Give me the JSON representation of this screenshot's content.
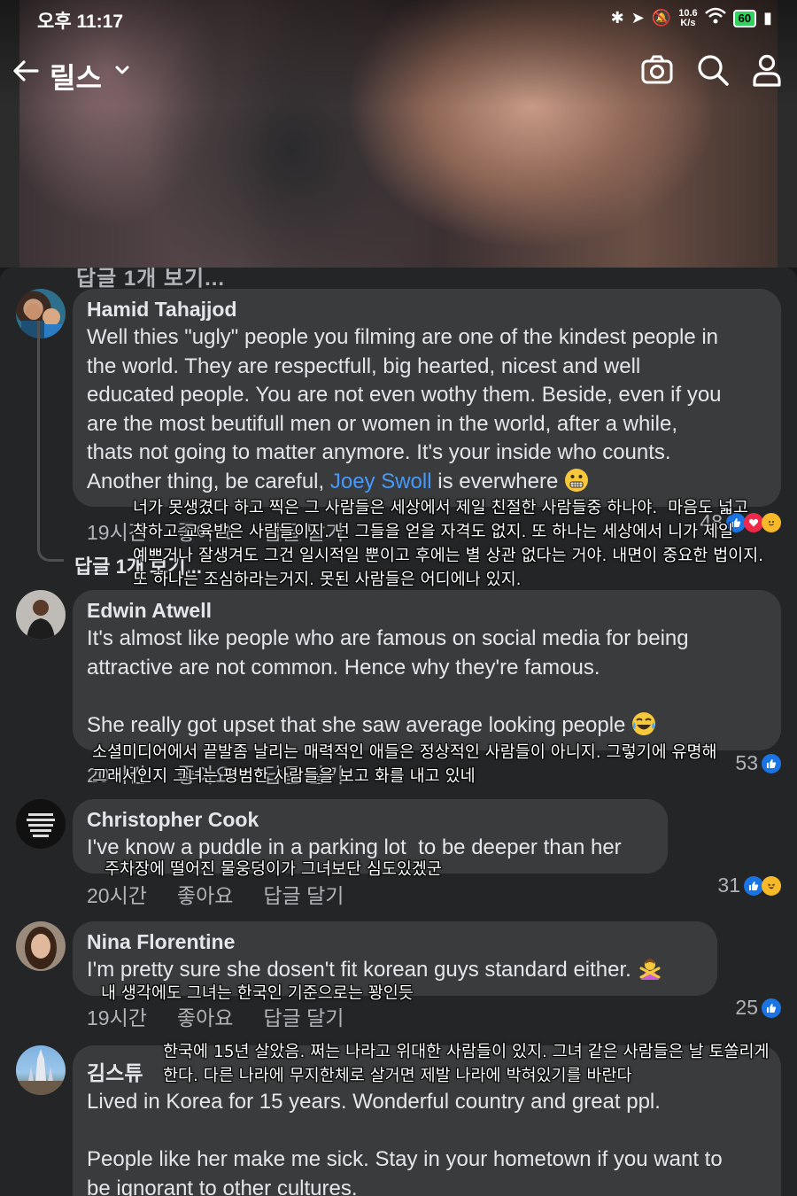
{
  "status": {
    "time": "오후 11:17",
    "speed_top": "10.6",
    "speed_bottom": "K/s",
    "battery": "60"
  },
  "header": {
    "title": "릴스",
    "icons": [
      "back-arrow-icon",
      "chevron-down-icon",
      "camera-icon",
      "search-icon",
      "profile-icon"
    ]
  },
  "sheet": {
    "cut_text": "답글 1개 보기...",
    "comments": [
      {
        "name": "Hamid Tahajjod",
        "text_before": "Well thies \"ugly\" people you filming are one of the kindest people in\nthe world. They are respectfull, big hearted, nicest and well\neducated people. You are not even wothy them. Beside, even if you\nare the most beutifull men or women in the world, after a while,\nthats not going to matter anymore. It's your inside who counts.\nAnother thing, be careful, ",
        "mention": "Joey Swoll",
        "text_after": " is everwhere",
        "time": "19시간",
        "like": "좋아요",
        "reply": "답글 달기",
        "reactions": "48",
        "replies_link": "답글 1개 보기...",
        "translation": "너가 못생겼다 하고 찍은 그 사람들은 세상에서 제일 친절한 사람들중 하나야.  마음도 넓고\n착하고 교육받은 사람들이지. 넌 그들을 얻을 자격도 없지. 또 하나는 세상에서 니가 제일\n예쁘거나 잘생겨도 그건 일시적일 뿐이고 후에는 별 상관 없다는 거야. 내면이 중요한 법이지.\n또 하나는 조심하라는거지. 못된 사람들은 어디에나 있지."
      },
      {
        "name": "Edwin Atwell",
        "text": "It's almost like people who are famous on social media for being\nattractive are not common. Hence why they're famous.\n\nShe really got upset that she saw average looking people",
        "time": "20시간",
        "like": "좋아요",
        "reply": "답글 달기",
        "reactions": "53",
        "translation": "소셜미디어에서 끝발좀 날리는 매력적인 애들은 정상적인 사람들이 아니지. 그렇기에 유명해\n그래서인지 그녀는 평범한 사람들을 보고 화를 내고 있네"
      },
      {
        "name": "Christopher Cook",
        "text": "I've know a puddle in a parking lot  to be deeper than her",
        "time": "20시간",
        "like": "좋아요",
        "reply": "답글 달기",
        "reactions": "31",
        "translation": "주차장에 떨어진 물웅덩이가 그녀보단 심도있겠군"
      },
      {
        "name": "Nina Florentine",
        "text": "I'm pretty sure she dosen't fit korean guys standard either.",
        "time": "19시간",
        "like": "좋아요",
        "reply": "답글 달기",
        "reactions": "25",
        "translation": "내 생각에도 그녀는 한국인 기준으로는 꽝인듯"
      },
      {
        "name": "김스튜",
        "text": "Lived in Korea for 15 years. Wonderful country and great ppl.\n\nPeople like her make me sick. Stay in your hometown if you want to\nbe ignorant to other cultures.",
        "translation": "한국에 15년 살았음. 쩌는 나라고 위대한 사람들이 있지. 그녀 같은 사람들은 날 토쏠리게\n한다. 다른 나라에 무지한체로 살거면 제발 나라에 박혀있기를 바란다"
      }
    ]
  },
  "colors": {
    "sheet_bg": "#242526",
    "bubble_bg": "#3a3b3c",
    "mention": "#4599ff",
    "like_blue": "#1b74e4",
    "love_red": "#f0284a",
    "haha_yellow": "#f7b928"
  }
}
